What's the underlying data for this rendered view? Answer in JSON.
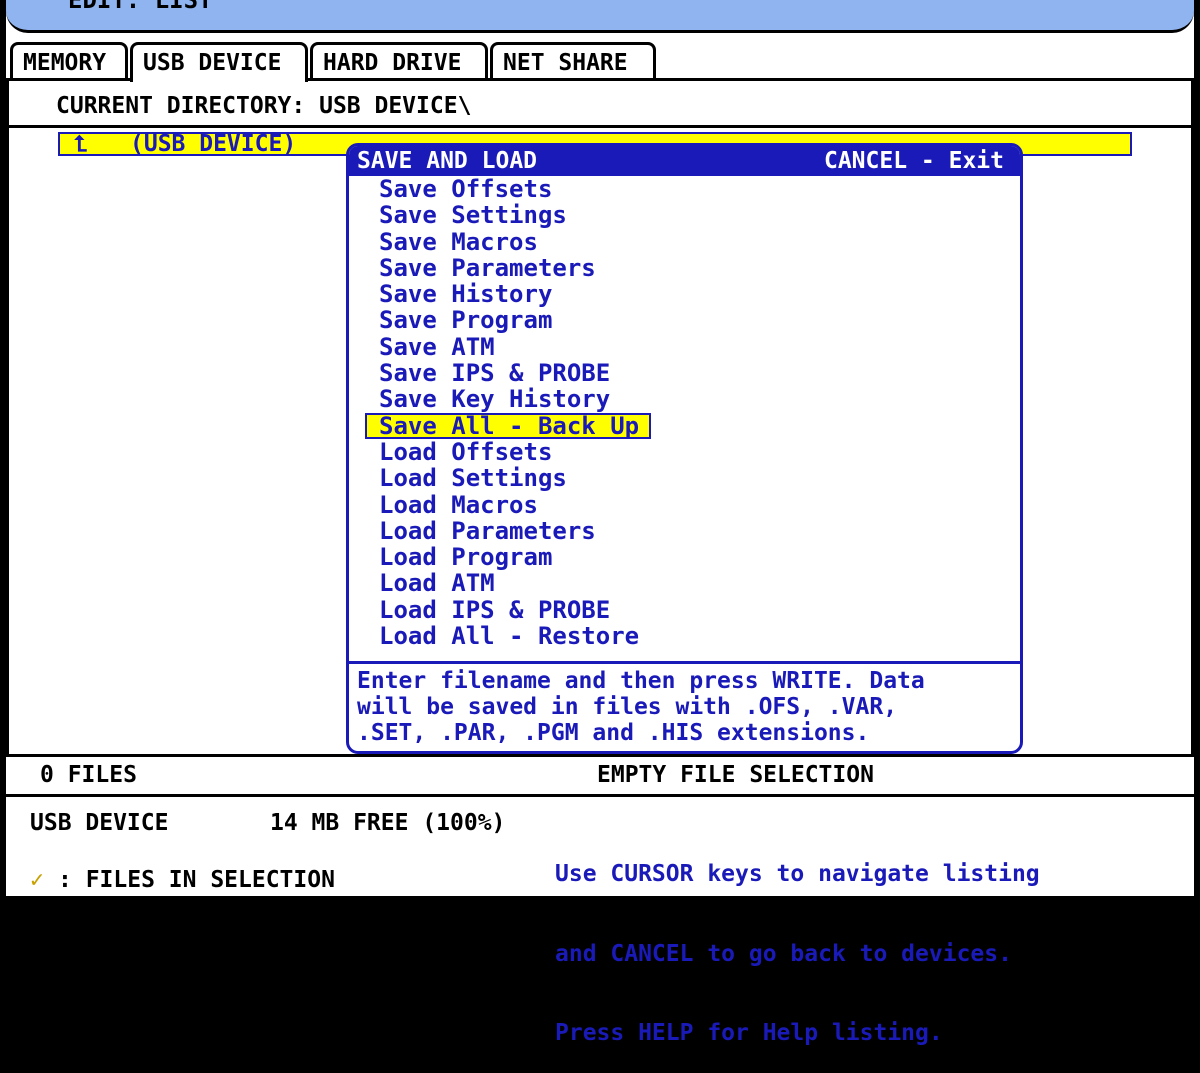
{
  "window": {
    "title": "EDIT: LIST"
  },
  "tabs": [
    {
      "label": "MEMORY"
    },
    {
      "label": "USB DEVICE"
    },
    {
      "label": "HARD DRIVE"
    },
    {
      "label": "NET SHARE"
    }
  ],
  "directory": {
    "label": "CURRENT DIRECTORY: USB DEVICE\\"
  },
  "listing": {
    "up_item_label": "(USB DEVICE)",
    "up_icon": "up-arrow-icon"
  },
  "dialog": {
    "title": "SAVE AND LOAD",
    "cancel_hint": "CANCEL - Exit",
    "items": [
      "Save Offsets",
      "Save Settings",
      "Save Macros",
      "Save Parameters",
      "Save History",
      "Save Program",
      "Save ATM",
      "Save IPS & PROBE",
      "Save Key History",
      "Save All - Back Up",
      "Load Offsets",
      "Load Settings",
      "Load Macros",
      "Load Parameters",
      "Load Program",
      "Load ATM",
      "Load IPS & PROBE",
      "Load All - Restore"
    ],
    "selected_index": 9,
    "help_line1": "Enter filename and then press WRITE. Data",
    "help_line2": "will be saved in files with .OFS, .VAR,",
    "help_line3": ".SET, .PAR, .PGM and .HIS extensions."
  },
  "status": {
    "file_count": "0 FILES",
    "selection": "EMPTY FILE SELECTION"
  },
  "footer": {
    "device": "USB DEVICE",
    "free": "14 MB FREE (100%)",
    "check_label": ": FILES IN SELECTION",
    "check_icon": "checkmark-icon",
    "help_line1": "Use CURSOR keys to navigate listing",
    "help_line2": "and CANCEL to go back to devices.",
    "help_line3": "Press HELP for Help listing."
  },
  "colors": {
    "accent": "#1a1ab8",
    "highlight": "#ffff00",
    "titlebar": "#8fb4f0",
    "check": "#c8a000"
  }
}
